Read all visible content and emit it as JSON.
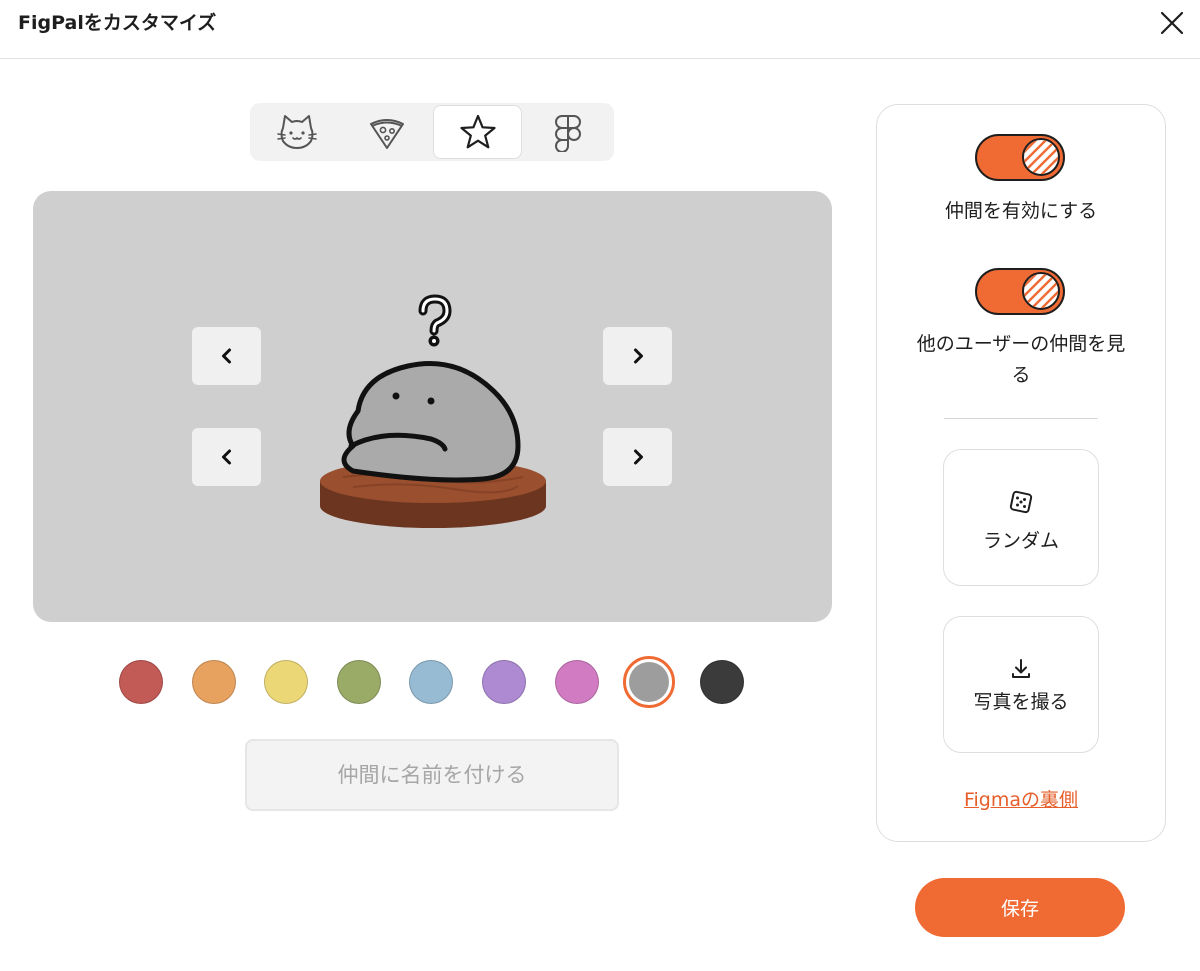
{
  "dialog": {
    "title": "FigPalをカスタマイズ"
  },
  "tabs": [
    {
      "icon": "cat-icon",
      "active": false
    },
    {
      "icon": "pizza-icon",
      "active": false
    },
    {
      "icon": "star-icon",
      "active": true
    },
    {
      "icon": "figma-icon",
      "active": false
    }
  ],
  "stage": {
    "background": "#cfcfcf",
    "arrows": [
      "chevron-left-icon",
      "chevron-right-icon",
      "chevron-left-icon",
      "chevron-right-icon"
    ],
    "character": {
      "name": "rock-character",
      "marker": "question-mark-icon"
    }
  },
  "colors": {
    "accent": "#f06a33",
    "swatches": [
      "#c25a56",
      "#e8a260",
      "#ecd777",
      "#9aab68",
      "#97bbd2",
      "#ad8ad2",
      "#d17cc2",
      "#9d9d9d",
      "#3b3b3b"
    ],
    "selected_index": 7
  },
  "name_input": {
    "placeholder": "仲間に名前を付ける",
    "value": ""
  },
  "panel": {
    "toggle_pals": {
      "label": "仲間を有効にする",
      "on": true
    },
    "toggle_others": {
      "label_line1": "他のユーザーの仲間を見",
      "label_line2": "る",
      "on": true
    },
    "random_label": "ランダム",
    "photo_label": "写真を撮る",
    "link_label": "Figmaの裏側"
  },
  "save_label": "保存"
}
